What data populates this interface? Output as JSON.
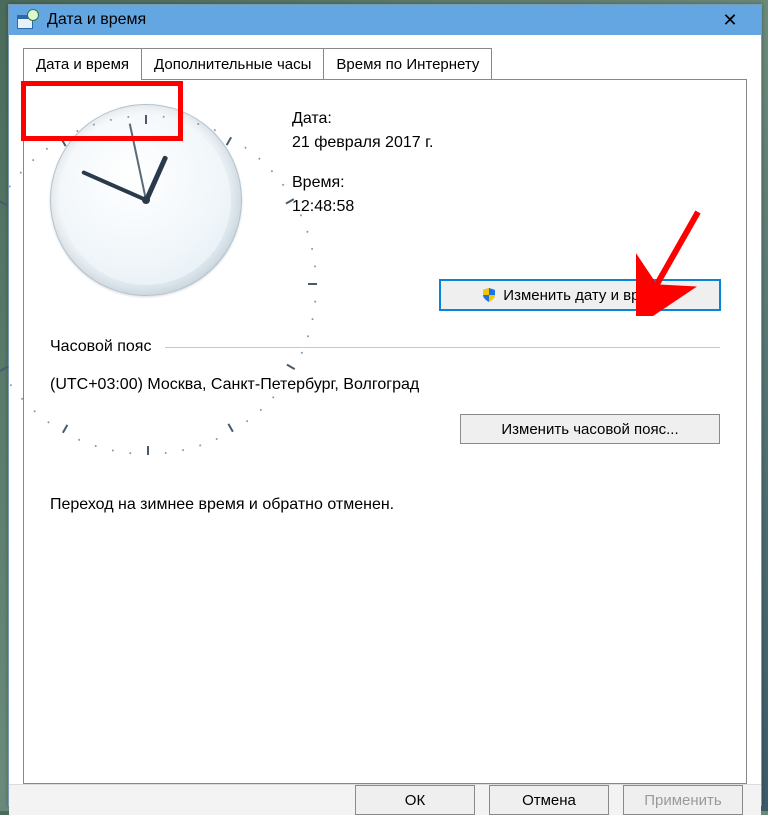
{
  "window": {
    "title": "Дата и время"
  },
  "tabs": [
    {
      "label": "Дата и время"
    },
    {
      "label": "Дополнительные часы"
    },
    {
      "label": "Время по Интернету"
    }
  ],
  "datetime": {
    "date_label": "Дата:",
    "date_value": "21 февраля 2017 г.",
    "time_label": "Время:",
    "time_value": "12:48:58",
    "change_button": "Изменить дату и время..."
  },
  "timezone": {
    "header": "Часовой пояс",
    "value": "(UTC+03:00) Москва, Санкт-Петербург, Волгоград",
    "change_button": "Изменить часовой пояс..."
  },
  "dst_notice": "Переход на зимнее время и обратно отменен.",
  "footer": {
    "ok": "ОК",
    "cancel": "Отмена",
    "apply": "Применить"
  },
  "clock": {
    "hour": 12,
    "minute": 48,
    "second": 58
  }
}
